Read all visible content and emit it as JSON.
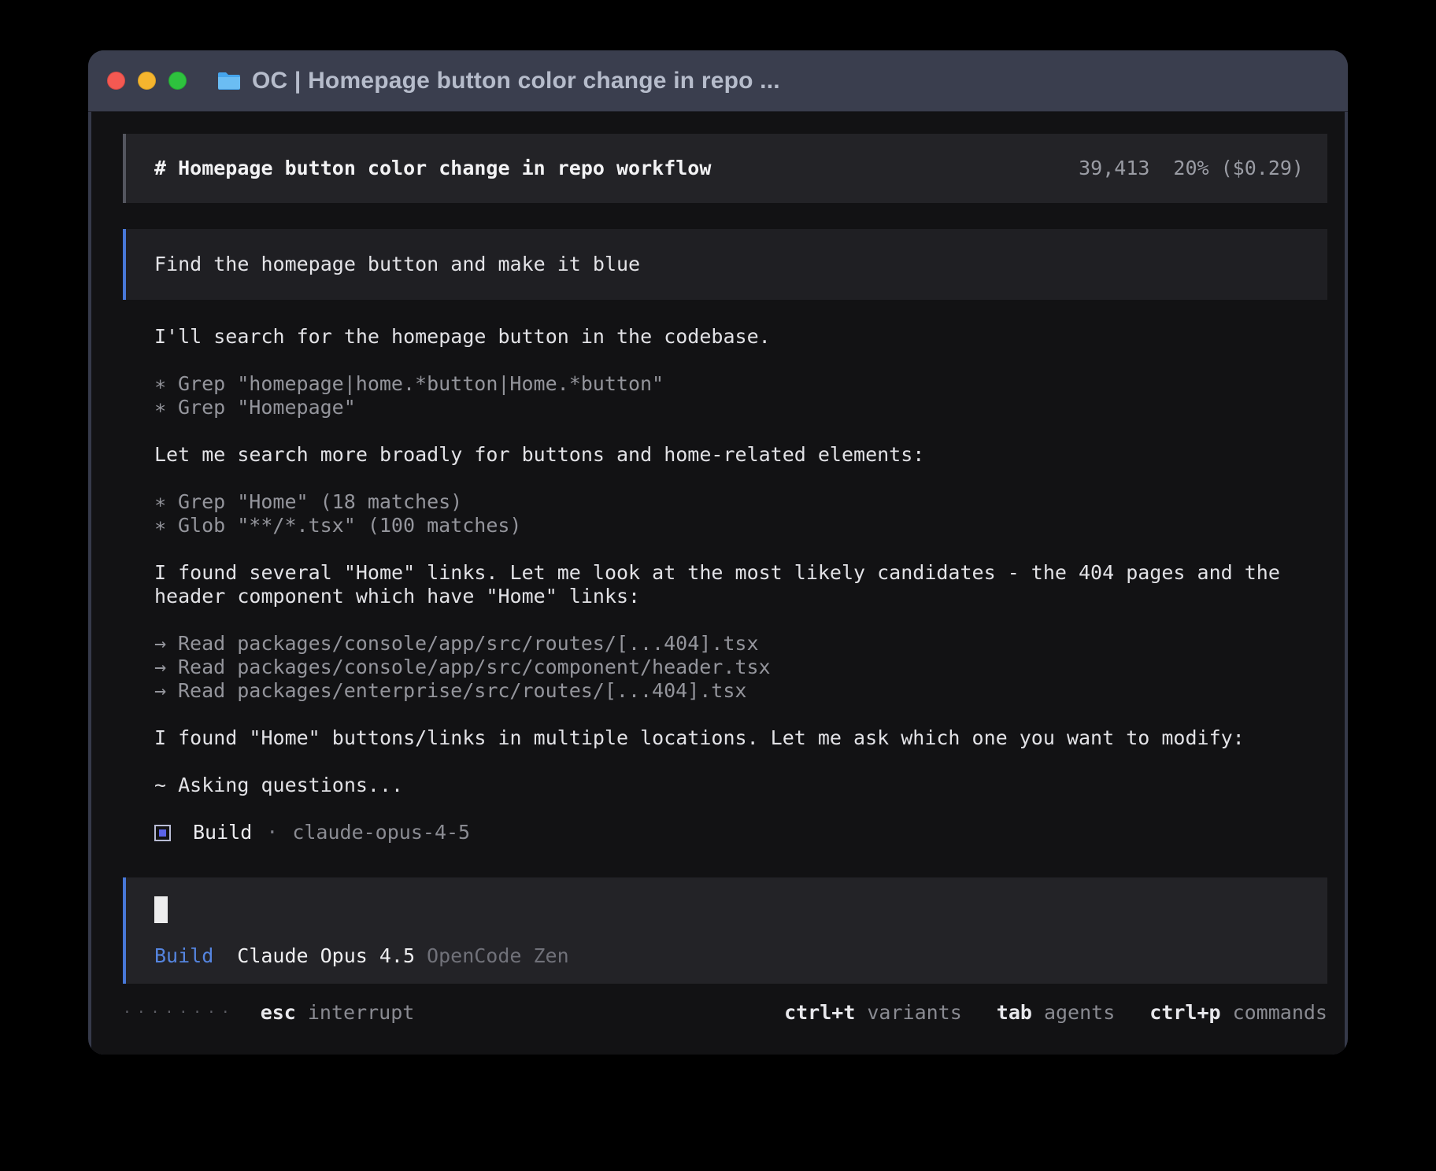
{
  "colors": {
    "accent_blue": "#4878d8",
    "build_blue": "#5585e0",
    "titlebar": "#3a3e4e",
    "terminal_bg": "#121214"
  },
  "titlebar": {
    "title": "OC | Homepage button color change in repo ..."
  },
  "session_header": {
    "title": "# Homepage button color change in repo workflow",
    "tokens": "39,413",
    "usage": "20% ($0.29)"
  },
  "user_message": {
    "text": "Find the homepage button and make it blue"
  },
  "assistant": {
    "intro": "I'll search for the homepage button in the codebase.",
    "tool_group_1": [
      {
        "bullet": "∗",
        "text": "Grep \"homepage|home.*button|Home.*button\""
      },
      {
        "bullet": "∗",
        "text": "Grep \"Homepage\""
      }
    ],
    "broader": "Let me search more broadly for buttons and home-related elements:",
    "tool_group_2": [
      {
        "bullet": "∗",
        "text": "Grep \"Home\" (18 matches)"
      },
      {
        "bullet": "∗",
        "text": "Glob \"**/*.tsx\" (100 matches)"
      }
    ],
    "found_links": "I found several \"Home\" links. Let me look at the most likely candidates - the 404 pages and the header component which have \"Home\" links:",
    "read_group": [
      {
        "bullet": "→",
        "text": "Read packages/console/app/src/routes/[...404].tsx"
      },
      {
        "bullet": "→",
        "text": "Read packages/console/app/src/component/header.tsx"
      },
      {
        "bullet": "→",
        "text": "Read packages/enterprise/src/routes/[...404].tsx"
      }
    ],
    "found_buttons": "I found \"Home\" buttons/links in multiple locations. Let me ask which one you want to modify:",
    "status": "~ Asking questions...",
    "agent_badge": {
      "label": "Build",
      "separator": "·",
      "model": "claude-opus-4-5"
    }
  },
  "input": {
    "status": {
      "agent": "Build",
      "model": "Claude Opus 4.5",
      "provider": "OpenCode Zen"
    }
  },
  "footer": {
    "spinner_dots": "········",
    "hints": [
      {
        "key": "esc",
        "label": "interrupt"
      },
      {
        "key": "ctrl+t",
        "label": "variants"
      },
      {
        "key": "tab",
        "label": "agents"
      },
      {
        "key": "ctrl+p",
        "label": "commands"
      }
    ]
  }
}
